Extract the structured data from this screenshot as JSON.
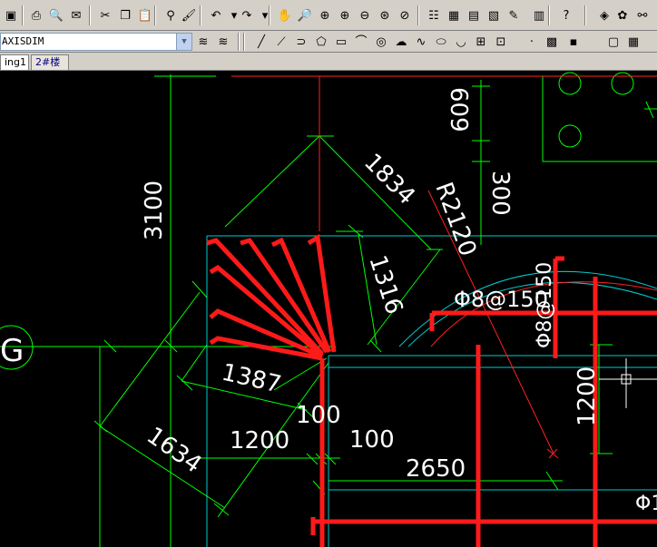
{
  "toolbar": {
    "layer_combo_value": "AXISDIM",
    "std_icons": [
      "save-icon",
      "print-icon",
      "print-preview-icon",
      "publish-icon",
      "cut-icon",
      "copy-icon",
      "paste-icon",
      "match-properties-icon",
      "paintbrush-icon",
      "undo-icon",
      "undo-dropdown-icon",
      "redo-icon",
      "redo-dropdown-icon",
      "pan-icon",
      "zoom-realtime-icon",
      "zoom-window-icon",
      "zoom-in-icon",
      "zoom-out-icon",
      "zoom-extents-icon",
      "zoom-previous-icon",
      "properties-icon",
      "design-center-icon",
      "tool-palettes-icon",
      "sheet-set-icon",
      "markup-icon",
      "calculator-icon",
      "help-icon",
      "layer-properties-icon",
      "layer-state-icon",
      "layer-previous-icon"
    ],
    "std_glyphs": [
      "▣",
      "⎙",
      "🔍",
      "✉",
      "✂",
      "❐",
      "📋",
      "⚲",
      "🖌",
      "↶",
      "▾",
      "↷",
      "▾",
      "✋",
      "🔎",
      "⊕",
      "⊕",
      "⊖",
      "⊛",
      "⊘",
      "☷",
      "▦",
      "▤",
      "▧",
      "✎",
      "▥",
      "?",
      "◈",
      "✿",
      "⚯"
    ],
    "draw_icons": [
      "layer-tools-icon",
      "layer-match-icon",
      "line-icon",
      "construction-line-icon",
      "polyline-icon",
      "polygon-icon",
      "rectangle-icon",
      "arc-icon",
      "circle-icon",
      "revision-cloud-icon",
      "spline-icon",
      "ellipse-icon",
      "ellipse-arc-icon",
      "insert-block-icon",
      "make-block-icon",
      "point-icon",
      "hatch-icon",
      "gradient-icon",
      "region-icon",
      "table-icon"
    ],
    "draw_glyphs": [
      "≋",
      "≋",
      "╱",
      "⟋",
      "⊃",
      "⬠",
      "▭",
      "⌒",
      "◎",
      "☁",
      "∿",
      "⬭",
      "◡",
      "⊞",
      "⊡",
      "·",
      "▩",
      "▪",
      "▢",
      "▦"
    ]
  },
  "tabs": {
    "model": "ing1",
    "layout": "2#楼"
  },
  "drawing": {
    "dims": {
      "d3100": "3100",
      "d1834": "1834",
      "dR2120": "R2120",
      "d609": "609",
      "d300": "300",
      "d1316": "1316",
      "d1387": "1387",
      "d1634": "1634",
      "d1200a": "1200",
      "d100a": "100",
      "d100b": "100",
      "d2650": "2650",
      "d1200b": "1200"
    },
    "rebar_label": "Φ8@150",
    "rebar_label_vertical": "Φ8@150",
    "grid_label": "G",
    "rebar_label_clipped": "Φ1"
  }
}
